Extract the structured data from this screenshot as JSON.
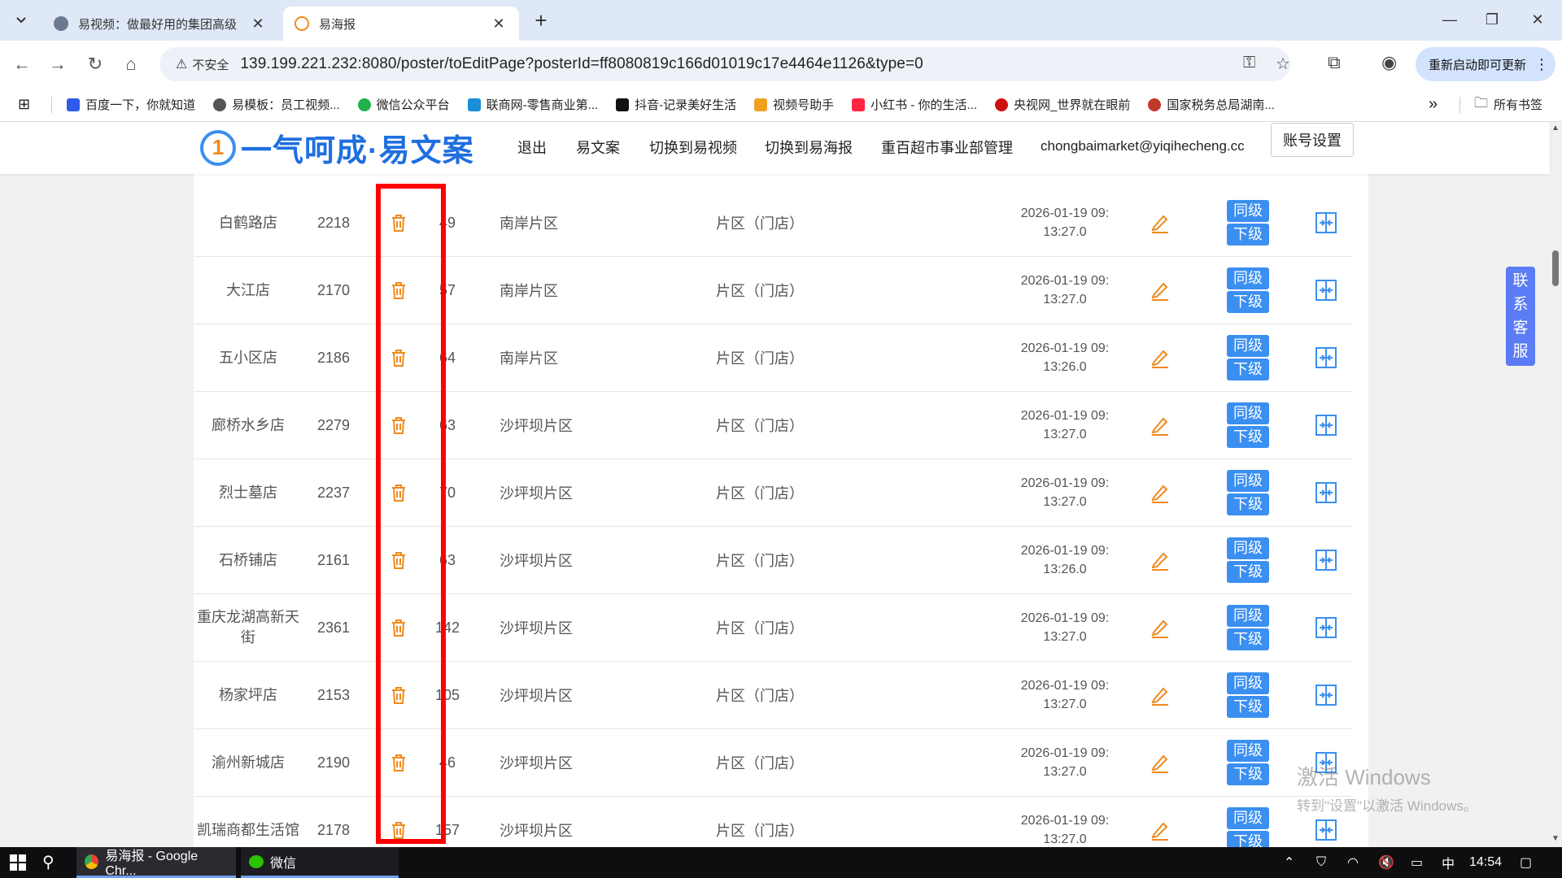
{
  "browser": {
    "tabs": [
      {
        "title": "易视频：做最好用的集团高级",
        "active": false
      },
      {
        "title": "易海报",
        "active": true
      }
    ],
    "new_tab": "+",
    "window_controls": {
      "minimize": "—",
      "maximize": "❐",
      "close": "✕"
    },
    "nav": {
      "back": "←",
      "forward": "→",
      "reload": "↻",
      "home": "⌂"
    },
    "insecure_label": "不安全",
    "url": "139.199.221.232:8080/poster/toEditPage?posterId=ff8080819c166d01019c17e4464e1126&type=0",
    "update_button": "重新启动即可更新",
    "bookmarks": [
      {
        "label": "百度一下，你就知道",
        "color": "#2f5bea"
      },
      {
        "label": "易模板：员工视频...",
        "color": "#555555"
      },
      {
        "label": "微信公众平台",
        "color": "#22b14c"
      },
      {
        "label": "联商网-零售商业第...",
        "color": "#1a8fd8"
      },
      {
        "label": "抖音-记录美好生活",
        "color": "#111111"
      },
      {
        "label": "视频号助手",
        "color": "#f0a020"
      },
      {
        "label": "小红书 - 你的生活...",
        "color": "#ff2442"
      },
      {
        "label": "央视网_世界就在眼前",
        "color": "#d01010"
      },
      {
        "label": "国家税务总局湖南...",
        "color": "#c0392b"
      }
    ],
    "bookmarks_more": "»",
    "all_bookmarks": "所有书签"
  },
  "site": {
    "logo_badge": "1",
    "logo_text": "一气呵成·易文案",
    "menu": [
      "退出",
      "易文案",
      "切换到易视频",
      "切换到易海报",
      "重百超市事业部管理",
      "chongbaimarket@yiqihecheng.cc"
    ],
    "account_button": "账号设置",
    "level_same": "同级",
    "level_sub": "下级",
    "rows": [
      {
        "name": "白鹤路店",
        "id": "2218",
        "num": "49",
        "area": "南岸片区",
        "type": "片区（门店）",
        "date": "2026-01-19 09:",
        "time": "13:27.0"
      },
      {
        "name": "大江店",
        "id": "2170",
        "num": "57",
        "area": "南岸片区",
        "type": "片区（门店）",
        "date": "2026-01-19 09:",
        "time": "13:27.0"
      },
      {
        "name": "五小区店",
        "id": "2186",
        "num": "64",
        "area": "南岸片区",
        "type": "片区（门店）",
        "date": "2026-01-19 09:",
        "time": "13:26.0"
      },
      {
        "name": "廊桥水乡店",
        "id": "2279",
        "num": "63",
        "area": "沙坪坝片区",
        "type": "片区（门店）",
        "date": "2026-01-19 09:",
        "time": "13:27.0"
      },
      {
        "name": "烈士墓店",
        "id": "2237",
        "num": "70",
        "area": "沙坪坝片区",
        "type": "片区（门店）",
        "date": "2026-01-19 09:",
        "time": "13:27.0"
      },
      {
        "name": "石桥铺店",
        "id": "2161",
        "num": "63",
        "area": "沙坪坝片区",
        "type": "片区（门店）",
        "date": "2026-01-19 09:",
        "time": "13:26.0"
      },
      {
        "name": "重庆龙湖高新天街",
        "id": "2361",
        "num": "142",
        "area": "沙坪坝片区",
        "type": "片区（门店）",
        "date": "2026-01-19 09:",
        "time": "13:27.0"
      },
      {
        "name": "杨家坪店",
        "id": "2153",
        "num": "105",
        "area": "沙坪坝片区",
        "type": "片区（门店）",
        "date": "2026-01-19 09:",
        "time": "13:27.0"
      },
      {
        "name": "渝州新城店",
        "id": "2190",
        "num": "46",
        "area": "沙坪坝片区",
        "type": "片区（门店）",
        "date": "2026-01-19 09:",
        "time": "13:27.0"
      },
      {
        "name": "凯瑞商都生活馆",
        "id": "2178",
        "num": "157",
        "area": "沙坪坝片区",
        "type": "片区（门店）",
        "date": "2026-01-19 09:",
        "time": "13:27.0"
      }
    ],
    "contact_service": [
      "联",
      "系",
      "客",
      "服"
    ]
  },
  "watermark": {
    "line1": "激活 Windows",
    "line2": "转到\"设置\"以激活 Windows。"
  },
  "taskbar": {
    "apps": [
      {
        "label": "易海报 - Google Chr..."
      },
      {
        "label": "微信"
      }
    ],
    "ime": "中",
    "clock": "14:54"
  },
  "colors": {
    "accent": "#3b8ff0",
    "delete_icon": "#f08a1c",
    "edit_icon": "#f08a1c",
    "highlight": "#ff0000",
    "contact_bg": "#5b7cf5"
  },
  "icons": {
    "delete": "trash-icon",
    "edit": "pencil-icon",
    "action": "expand-arrows-icon"
  }
}
